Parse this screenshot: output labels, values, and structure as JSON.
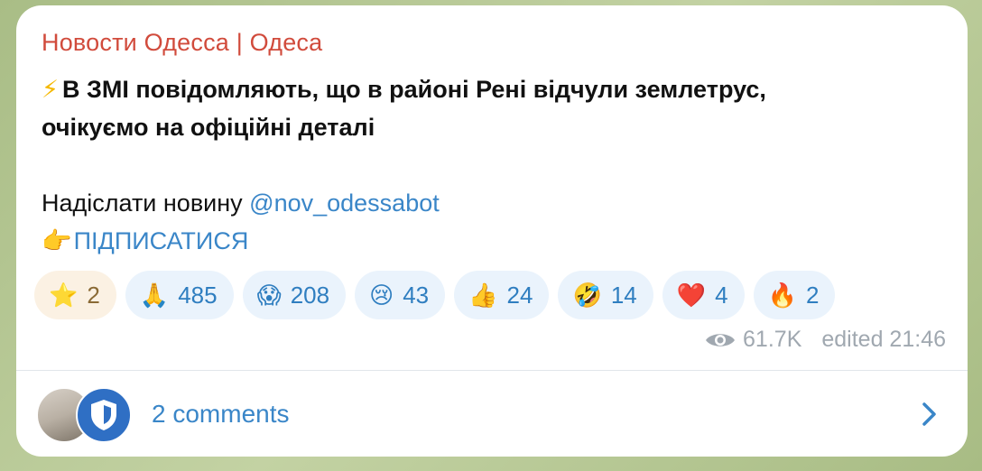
{
  "post": {
    "channel_name": "Новости Одесса | Одеса",
    "bolt_emoji": "⚡",
    "line1": "В ЗМІ повідомляють, що в районі Рені відчули землетрус,",
    "line2": "очікуємо на офіційні деталі",
    "send_prefix": "Надіслати новину ",
    "send_link": "@nov_odessabot",
    "subscribe_emoji": "👉",
    "subscribe_label": "ПІДПИСАТИСЯ"
  },
  "reactions": [
    {
      "emoji": "⭐",
      "count": "2"
    },
    {
      "emoji": "🙏",
      "count": "485"
    },
    {
      "emoji": "😱",
      "count": "208"
    },
    {
      "emoji": "😢",
      "count": "43"
    },
    {
      "emoji": "👍",
      "count": "24"
    },
    {
      "emoji": "🤣",
      "count": "14"
    },
    {
      "emoji": "❤️",
      "count": "4"
    },
    {
      "emoji": "🔥",
      "count": "2"
    }
  ],
  "meta": {
    "views": "61.7K",
    "edited": "edited 21:46"
  },
  "comments": {
    "label": "2 comments"
  },
  "colors": {
    "channel_name": "#d14b3c",
    "link": "#3a86c8",
    "reaction_bg": "#eaf3fc",
    "paid_reaction_bg": "#fbf1e3"
  }
}
